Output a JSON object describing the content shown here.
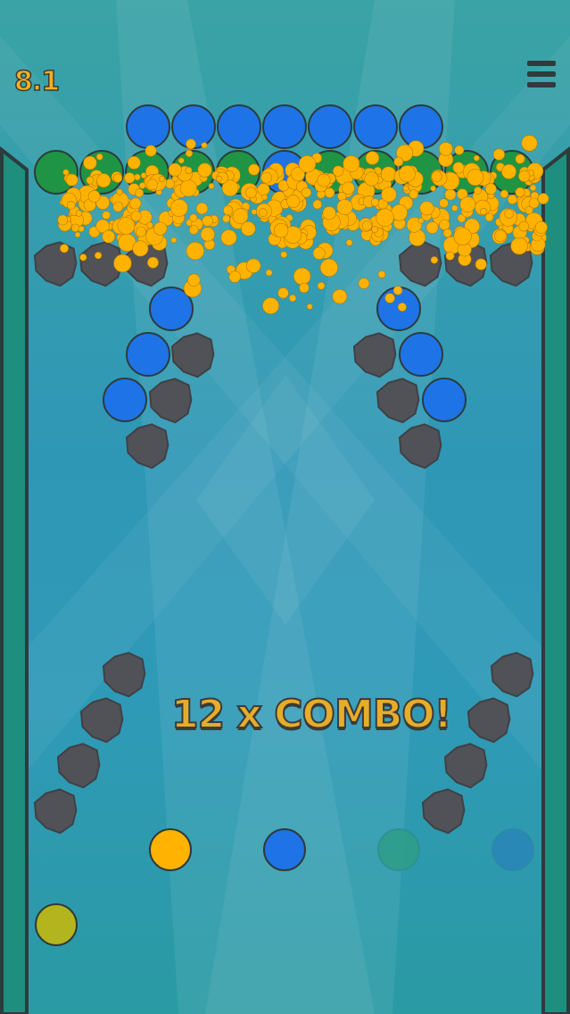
{
  "hud": {
    "score": "8.1",
    "menu_icon": "hamburger-menu-icon"
  },
  "combo": {
    "text": "12 x COMBO!"
  },
  "colors": {
    "blue": "#1e74e6",
    "green": "#1f9444",
    "rock": "#505257",
    "yellow": "#ffb300",
    "olive": "#b4b41e",
    "rail": "#1f8f80",
    "outline": "#2d3b3d"
  },
  "launcher_queue": [
    "yellow",
    "blue",
    "green-faded",
    "blue-faded"
  ],
  "current_ball": "olive"
}
